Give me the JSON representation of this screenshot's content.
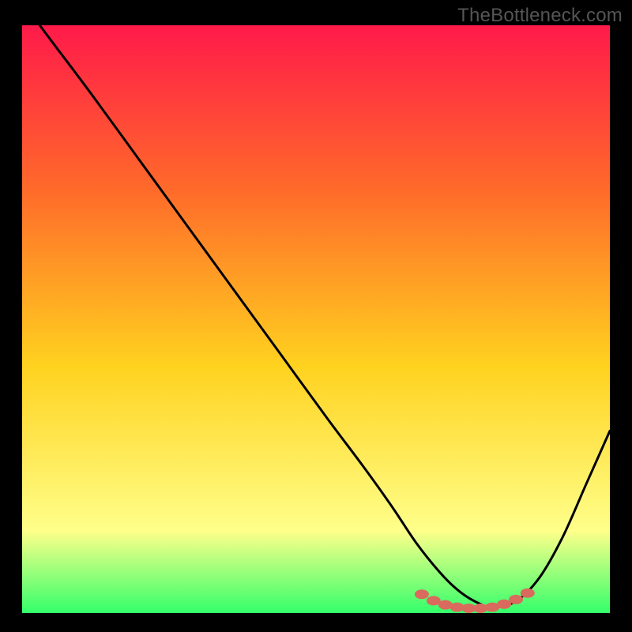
{
  "watermark": {
    "text": "TheBottleneck.com"
  },
  "colors": {
    "bg": "#000000",
    "grad_top": "#ff1a4a",
    "grad_mid_upper": "#ff6a2a",
    "grad_mid": "#ffd21f",
    "grad_low": "#ffff8a",
    "grad_bottom": "#34ff6b",
    "curve": "#000000",
    "marker": "#d96a5d"
  },
  "chart_data": {
    "type": "line",
    "title": "",
    "xlabel": "",
    "ylabel": "",
    "xlim": [
      0,
      100
    ],
    "ylim": [
      0,
      100
    ],
    "series": [
      {
        "name": "bottleneck-curve",
        "x": [
          3,
          6,
          12,
          20,
          28,
          36,
          44,
          52,
          58,
          63,
          67,
          71,
          74,
          77,
          80,
          84,
          88,
          92,
          96,
          100
        ],
        "values": [
          100,
          96,
          88,
          77,
          66,
          55,
          44,
          33,
          25,
          18,
          12,
          7,
          4,
          2,
          1,
          2,
          6,
          13,
          22,
          31
        ]
      }
    ],
    "markers": {
      "name": "optimal-range-dots",
      "x": [
        68,
        70,
        72,
        74,
        76,
        78,
        80,
        82,
        84,
        86
      ],
      "values": [
        3.2,
        2.1,
        1.4,
        1.0,
        0.8,
        0.8,
        1.0,
        1.5,
        2.3,
        3.4
      ]
    }
  }
}
